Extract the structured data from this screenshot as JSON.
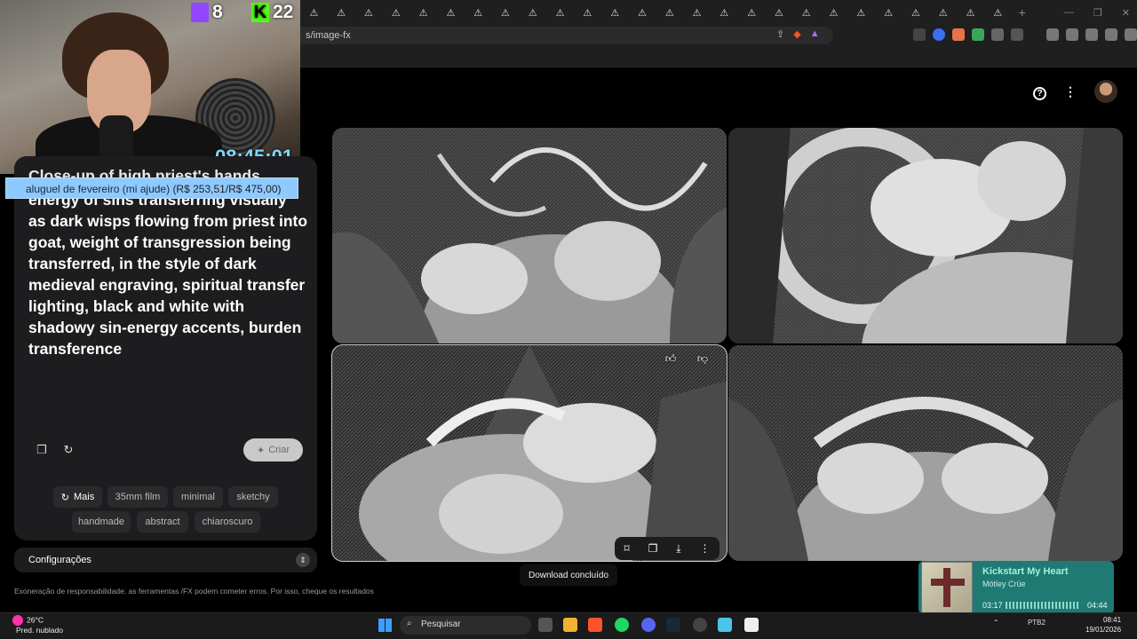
{
  "browser": {
    "tab_count": 26,
    "tab_glyph": "⚠",
    "new_tab": "+",
    "window_controls": [
      "—",
      "❐",
      "✕"
    ],
    "url": "s/image-fx"
  },
  "stream": {
    "twitch_count": "8",
    "kick_count": "22",
    "clock": "08:45:01",
    "goal_label": "aluguel de fevereiro (mi ajude)",
    "goal_amount": "(R$ 253,51/R$ 475,00)"
  },
  "prompt": {
    "text": "pressed on goat's head, mystical energy of sins transferring visually as dark wisps flowing from priest into goat, weight of transgression being transferred, in the style of dark medieval engraving, spiritual transfer lighting, black and white with shadowy sin-energy accents, burden transference",
    "partial_top": "Close-up of high priest's hands"
  },
  "actions": {
    "copy_icon": "copy-icon",
    "reset_icon": "refresh-icon",
    "criar_label": "Criar"
  },
  "chips": [
    {
      "label": "Mais"
    },
    {
      "label": "35mm film"
    },
    {
      "label": "minimal"
    },
    {
      "label": "sketchy"
    },
    {
      "label": "handmade"
    },
    {
      "label": "abstract"
    },
    {
      "label": "chiaroscuro"
    }
  ],
  "settings": {
    "label": "Configurações"
  },
  "disclaimer": "Exoneração de responsabilidade: as ferramentas /FX podem cometer erros. Por isso, cheque os resultados",
  "header": {
    "help_icon": "?",
    "menu_icon": "⋮"
  },
  "toast": "Download concluído",
  "music": {
    "song": "Kickstart My Heart",
    "artist": "Mötley Crüe",
    "elapsed": "03:17",
    "total": "04:44",
    "progress": 0.69
  },
  "taskbar": {
    "temp": "26°C",
    "weather": "Pred. nublado",
    "search_placeholder": "Pesquisar",
    "lang": "PTB2",
    "time": "08:41",
    "date": "19/01/2026"
  },
  "colors": {
    "panel": "#1d1d1f",
    "accent_music": "#1f7a74",
    "goal_bar": "#8ec9ff"
  }
}
